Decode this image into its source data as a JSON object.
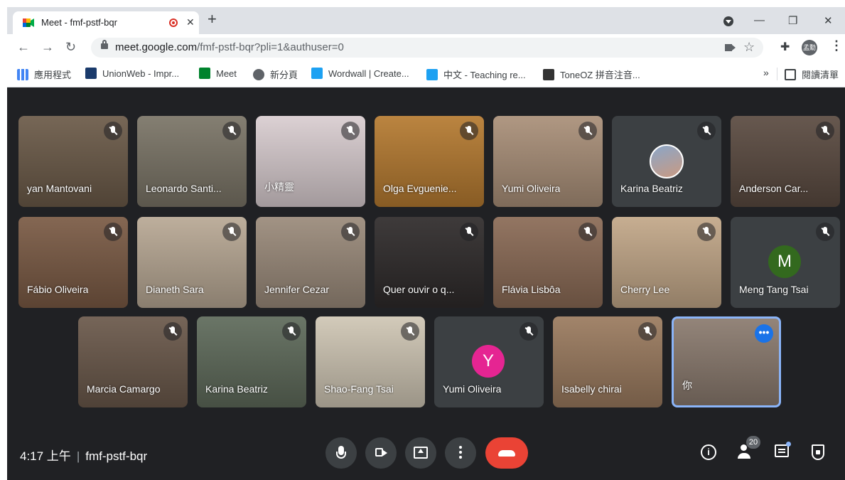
{
  "browser": {
    "tab_title": "Meet - fmf-pstf-bqr",
    "tab_close": "✕",
    "new_tab": "+",
    "url_host": "meet.google.com",
    "url_path": "/fmf-pstf-bqr?pli=1&authuser=0",
    "profile_initials": "孟勳",
    "window_min": "—",
    "window_restore": "❐",
    "window_close": "✕"
  },
  "bookmarks": [
    {
      "label": "應用程式",
      "color": "#4285f4"
    },
    {
      "label": "UnionWeb - Impr...",
      "color": "#1a3a6b"
    },
    {
      "label": "Meet",
      "color": "#00832d"
    },
    {
      "label": "新分頁",
      "color": "#5f6368"
    },
    {
      "label": "Wordwall | Create...",
      "color": "#1da1f2"
    },
    {
      "label": "中文 - Teaching re...",
      "color": "#1da1f2"
    },
    {
      "label": "ToneOZ 拼音注音...",
      "color": "#333333"
    }
  ],
  "bookmarks_more": "»",
  "reading_list": "閱讀清單",
  "participants": [
    {
      "name": "yan Mantovani",
      "type": "video",
      "bg": "#6b5a48"
    },
    {
      "name": "Leonardo Santi...",
      "type": "video",
      "bg": "#7a7466"
    },
    {
      "name": "小精靈",
      "type": "video",
      "bg": "#d9cdd0"
    },
    {
      "name": "Olga Evguenie...",
      "type": "video",
      "bg": "#b57a30"
    },
    {
      "name": "Yumi Oliveira",
      "type": "video",
      "bg": "#a98f78"
    },
    {
      "name": "Karina Beatriz",
      "type": "avatar",
      "bg": "#3c4043"
    },
    {
      "name": "Anderson Car...",
      "type": "video",
      "bg": "#5a4a40"
    },
    {
      "name": "Fábio Oliveira",
      "type": "video",
      "bg": "#7a5a44"
    },
    {
      "name": "Dianeth Sara",
      "type": "video",
      "bg": "#b8a894"
    },
    {
      "name": "Jennifer Cezar",
      "type": "video",
      "bg": "#9a8a7a"
    },
    {
      "name": "Quer ouvir o q...",
      "type": "video",
      "bg": "#2e2a2a"
    },
    {
      "name": "Flávia Lisbôa",
      "type": "video",
      "bg": "#8a6a55"
    },
    {
      "name": "Cherry Lee",
      "type": "video",
      "bg": "#c2a788"
    },
    {
      "name": "Meng Tang Tsai",
      "type": "letter",
      "letter": "M",
      "bg": "#3c4043",
      "avatar_color": "#33691e"
    },
    {
      "name": "Marcia Camargo",
      "type": "video",
      "bg": "#6a584a"
    },
    {
      "name": "Karina Beatriz",
      "type": "video",
      "bg": "#5e6a5a"
    },
    {
      "name": "Shao-Fang Tsai",
      "type": "video",
      "bg": "#cfc6b4"
    },
    {
      "name": "Yumi Oliveira",
      "type": "letter",
      "letter": "Y",
      "bg": "#3c4043",
      "avatar_color": "#e52592"
    },
    {
      "name": "Isabelly chirai",
      "type": "video",
      "bg": "#9a7a5e"
    },
    {
      "name": "你",
      "type": "self",
      "bg": "#8a7a6e"
    }
  ],
  "meeting": {
    "time": "4:17 上午",
    "separator": "|",
    "code": "fmf-pstf-bqr",
    "participant_count": "20",
    "info_glyph": "i",
    "more_glyph": "•••"
  }
}
